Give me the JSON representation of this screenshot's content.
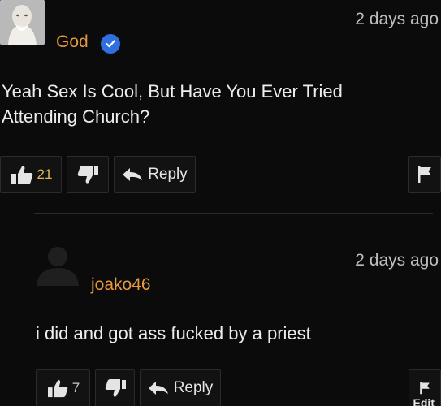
{
  "comment1": {
    "author": "God",
    "time": "2 days ago",
    "text": "Yeah Sex Is Cool, But Have You Ever Tried Attending Church?",
    "like_count": "21",
    "reply_label": "Reply"
  },
  "comment2": {
    "author": "joako46",
    "time": "2 days ago",
    "text": "i did and got ass fucked by a priest",
    "like_count": "7",
    "reply_label": "Reply",
    "edit_label": "Edit"
  },
  "colors": {
    "username": "#e79a3d",
    "verified": "#2f6fe0",
    "background": "#0b0b0b"
  },
  "icons": [
    "avatar-god",
    "verified-icon",
    "thumbs-up-icon",
    "thumbs-down-icon",
    "reply-arrow-icon",
    "flag-icon",
    "default-avatar"
  ]
}
